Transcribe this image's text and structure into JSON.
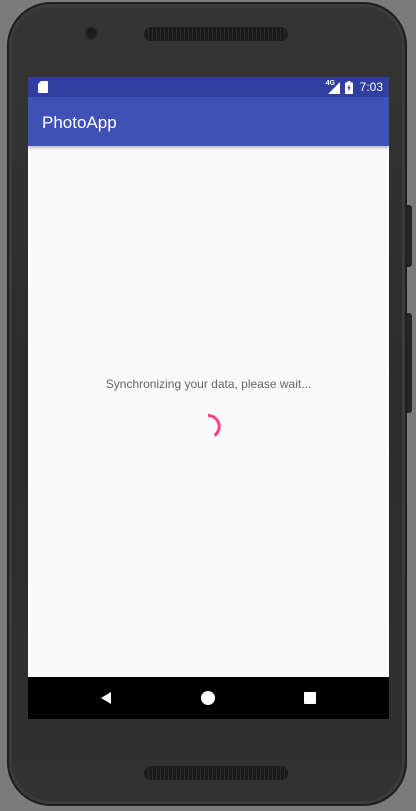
{
  "status_bar": {
    "network_label": "4G",
    "time": "7:03",
    "icons": [
      "sd-card-icon",
      "signal-icon",
      "battery-charging-icon"
    ]
  },
  "app_bar": {
    "title": "PhotoApp"
  },
  "main": {
    "message": "Synchronizing your data, please wait...",
    "spinner_icon": "progress-spinner-icon"
  },
  "nav_bar": {
    "icons": [
      "back-icon",
      "home-icon",
      "recents-icon"
    ]
  },
  "colors": {
    "status_bar": "#303f9f",
    "app_bar": "#3f51b5",
    "accent": "#ff4081",
    "background": "#fafafa",
    "nav_bar": "#000000"
  }
}
